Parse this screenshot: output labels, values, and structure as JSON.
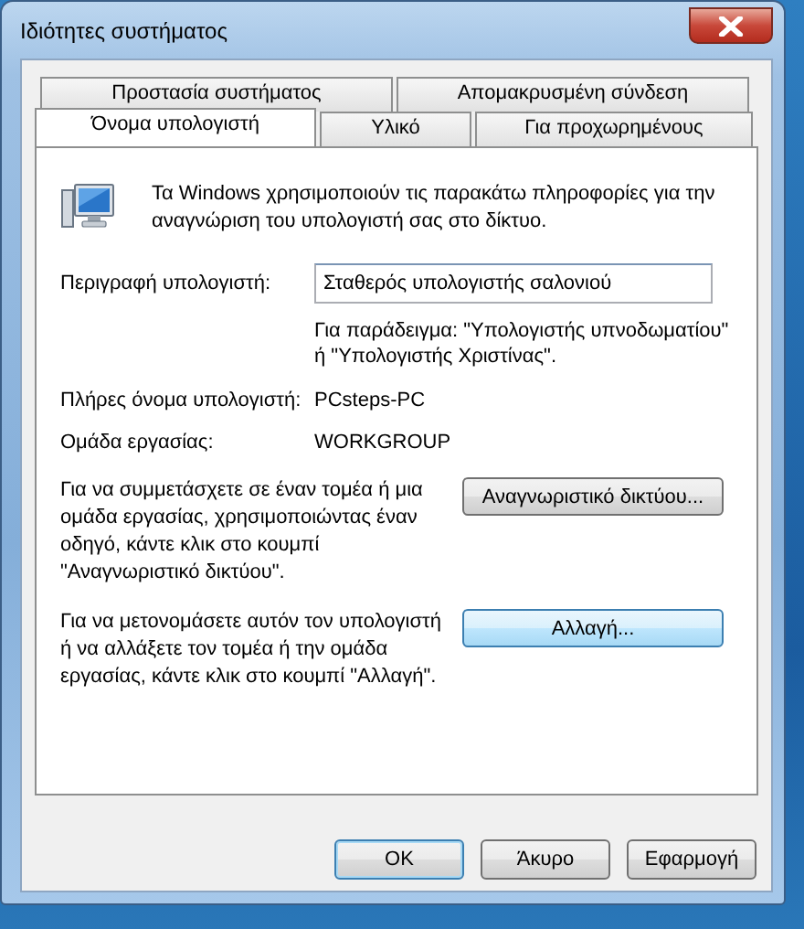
{
  "window": {
    "title": "Ιδιότητες συστήματος"
  },
  "tab_rows": [
    [
      {
        "label": "Προστασία συστήματος",
        "selected": false
      },
      {
        "label": "Απομακρυσμένη σύνδεση",
        "selected": false
      }
    ],
    [
      {
        "label": "Όνομα υπολογιστή",
        "selected": true
      },
      {
        "label": "Υλικό",
        "selected": false
      },
      {
        "label": "Για προχωρημένους",
        "selected": false
      }
    ]
  ],
  "intro": "Τα Windows χρησιμοποιούν τις παρακάτω πληροφορίες για την αναγνώριση του υπολογιστή σας στο δίκτυο.",
  "description": {
    "label": "Περιγραφή υπολογιστή:",
    "value": "Σταθερός υπολογιστής σαλονιού",
    "hint": "Για παράδειγμα: \"Υπολογιστής υπνοδωματίου\" ή \"Υπολογιστής Χριστίνας\"."
  },
  "info": [
    {
      "label": "Πλήρες όνομα υπολογιστή:",
      "value": "PCsteps-PC"
    },
    {
      "label": "Ομάδα εργασίας:",
      "value": "WORKGROUP"
    }
  ],
  "actions": [
    {
      "text": "Για να συμμετάσχετε σε έναν τομέα ή μια ομάδα εργασίας, χρησιμοποιώντας έναν οδηγό, κάντε κλικ στο κουμπί \"Αναγνωριστικό δικτύου\".",
      "button": "Αναγνωριστικό δικτύου...",
      "hover": false
    },
    {
      "text": "Για να μετονομάσετε αυτόν τον υπολογιστή ή να αλλάξετε τον τομέα ή την ομάδα εργασίας, κάντε κλικ στο κουμπί \"Αλλαγή\".",
      "button": "Αλλαγή...",
      "hover": true
    }
  ],
  "buttons": [
    {
      "label": "OK",
      "default": true
    },
    {
      "label": "Άκυρο",
      "default": false
    },
    {
      "label": "Εφαρμογή",
      "default": false
    }
  ]
}
